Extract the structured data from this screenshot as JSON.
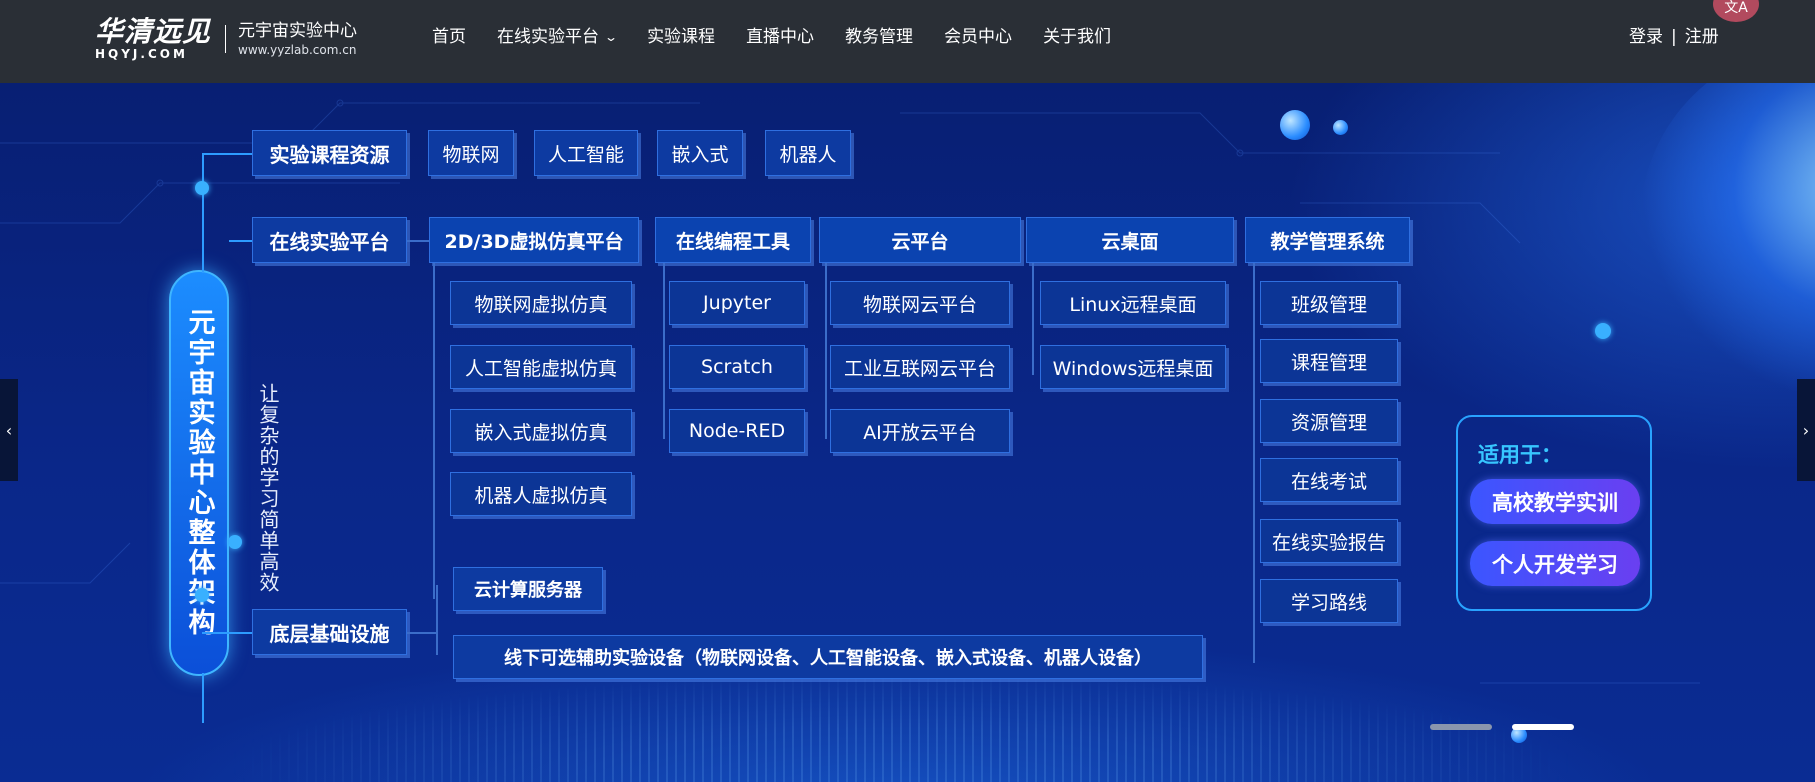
{
  "header": {
    "logo_cn": "华清远见",
    "logo_en": "HQYJ.COM",
    "logo_sub_cn": "元宇宙实验中心",
    "logo_sub_url": "www.yyzlab.com.cn",
    "nav": [
      {
        "label": "首页"
      },
      {
        "label": "在线实验平台",
        "chevron": "⌄"
      },
      {
        "label": "实验课程"
      },
      {
        "label": "直播中心"
      },
      {
        "label": "教务管理"
      },
      {
        "label": "会员中心"
      },
      {
        "label": "关于我们"
      }
    ],
    "login": "登录",
    "separator": "|",
    "register": "注册",
    "translate_icon": "文A"
  },
  "banner": {
    "center_title": "元宇宙实验中心整体架构",
    "center_subtitle": "让复杂的学习简单高效",
    "course_resources": {
      "label": "实验课程资源",
      "items": [
        "物联网",
        "人工智能",
        "嵌入式",
        "机器人"
      ]
    },
    "online_platform": {
      "label": "在线实验平台",
      "columns": [
        {
          "title": "2D/3D虚拟仿真平台",
          "items": [
            "物联网虚拟仿真",
            "人工智能虚拟仿真",
            "嵌入式虚拟仿真",
            "机器人虚拟仿真"
          ]
        },
        {
          "title": "在线编程工具",
          "items": [
            "Jupyter",
            "Scratch",
            "Node-RED"
          ]
        },
        {
          "title": "云平台",
          "items": [
            "物联网云平台",
            "工业互联网云平台",
            "AI开放云平台"
          ]
        },
        {
          "title": "云桌面",
          "items": [
            "Linux远程桌面",
            "Windows远程桌面"
          ]
        },
        {
          "title": "教学管理系统",
          "items": [
            "班级管理",
            "课程管理",
            "资源管理",
            "在线考试",
            "在线实验报告",
            "学习路线"
          ]
        }
      ]
    },
    "infrastructure": {
      "label": "底层基础设施",
      "items": [
        "云计算服务器",
        "线下可选辅助实验设备（物联网设备、人工智能设备、嵌入式设备、机器人设备）"
      ]
    },
    "applicable": {
      "title": "适用于：",
      "items": [
        "高校教学实训",
        "个人开发学习"
      ]
    },
    "prev_arrow": "‹",
    "next_arrow": "›",
    "slides": {
      "count": 2,
      "active": 2
    }
  }
}
